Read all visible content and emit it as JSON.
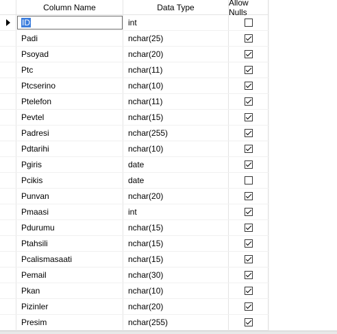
{
  "headers": {
    "name": "Column Name",
    "type": "Data Type",
    "nulls": "Allow Nulls"
  },
  "rows": [
    {
      "name": "ID",
      "type": "int",
      "nulls": false
    },
    {
      "name": "Padi",
      "type": "nchar(25)",
      "nulls": true
    },
    {
      "name": "Psoyad",
      "type": "nchar(20)",
      "nulls": true
    },
    {
      "name": "Ptc",
      "type": "nchar(11)",
      "nulls": true
    },
    {
      "name": "Ptcserino",
      "type": "nchar(10)",
      "nulls": true
    },
    {
      "name": "Ptelefon",
      "type": "nchar(11)",
      "nulls": true
    },
    {
      "name": "Pevtel",
      "type": "nchar(15)",
      "nulls": true
    },
    {
      "name": "Padresi",
      "type": "nchar(255)",
      "nulls": true
    },
    {
      "name": "Pdtarihi",
      "type": "nchar(10)",
      "nulls": true
    },
    {
      "name": "Pgiris",
      "type": "date",
      "nulls": true
    },
    {
      "name": "Pcikis",
      "type": "date",
      "nulls": false
    },
    {
      "name": "Punvan",
      "type": "nchar(20)",
      "nulls": true
    },
    {
      "name": "Pmaasi",
      "type": "int",
      "nulls": true
    },
    {
      "name": "Pdurumu",
      "type": "nchar(15)",
      "nulls": true
    },
    {
      "name": "Ptahsili",
      "type": "nchar(15)",
      "nulls": true
    },
    {
      "name": "Pcalismasaati",
      "type": "nchar(15)",
      "nulls": true
    },
    {
      "name": "Pemail",
      "type": "nchar(30)",
      "nulls": true
    },
    {
      "name": "Pkan",
      "type": "nchar(10)",
      "nulls": true
    },
    {
      "name": "Pizinler",
      "type": "nchar(20)",
      "nulls": true
    },
    {
      "name": "Presim",
      "type": "nchar(255)",
      "nulls": true
    }
  ]
}
